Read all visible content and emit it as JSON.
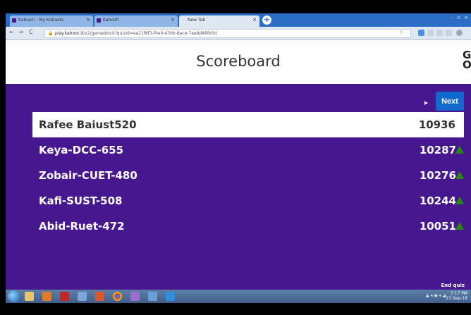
{
  "browser": {
    "tabs": [
      {
        "label": "Kahoot! - My Kahoots",
        "close": "×"
      },
      {
        "label": "Kahoot!",
        "close": "×"
      },
      {
        "label": "New Tab",
        "close": "×"
      }
    ],
    "new_tab_glyph": "+",
    "window_controls": [
      "–",
      "▫",
      "×"
    ],
    "url_host": "play.kahoot.it",
    "url_path": "/v2/gameblock?quizId=ea11f8f3-f0e0-43bb-8ace-7ea8d48fe5d"
  },
  "page": {
    "title": "Scoreboard",
    "logo_text": "G\nO",
    "next_label": "Next",
    "cursor": "➤",
    "end_quiz_label": "End quiz"
  },
  "scoreboard": [
    {
      "name": "Rafee Baiust520",
      "score": "10936",
      "trend": "none"
    },
    {
      "name": "Keya-DCC-655",
      "score": "10287",
      "trend": "up"
    },
    {
      "name": "Zobair-CUET-480",
      "score": "10276",
      "trend": "up"
    },
    {
      "name": "Kafi-SUST-508",
      "score": "10244",
      "trend": "up"
    },
    {
      "name": "Abid-Ruet-472",
      "score": "10051",
      "trend": "up"
    }
  ],
  "taskbar": {
    "tray_text": "▲ ◂ ◉ ◂ ◢",
    "time": "7:17 PM",
    "date": "17-Sep-18"
  },
  "colors": {
    "kahoot_purple": "#46178f",
    "next_blue": "#1368ce",
    "up_green": "#26890c"
  },
  "icons": [
    "lock-icon",
    "back-icon",
    "forward-icon",
    "reload-icon",
    "star-icon",
    "trend-up-icon",
    "start-orb-icon"
  ]
}
